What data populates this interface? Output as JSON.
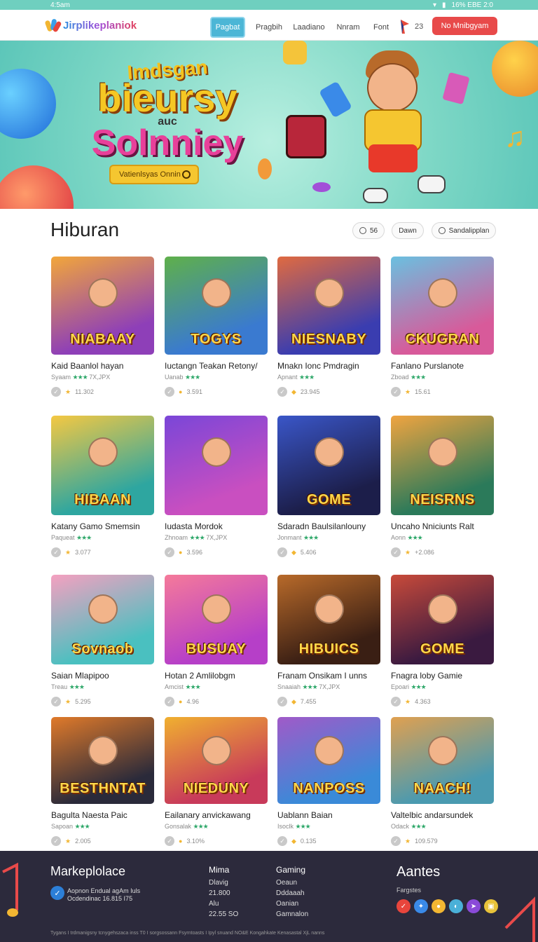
{
  "status_bar": {
    "time": "4:5am",
    "right": "16% EBE 2:0"
  },
  "nav": {
    "logo": "Jirplikeplaniok",
    "tabs": [
      "Pagbat",
      "Pragbih",
      "Laadiano",
      "Nnram",
      "Font"
    ],
    "badge_count": "23",
    "cta": "No Mnibgyam"
  },
  "hero": {
    "title_line1": "Imdsgan",
    "title_line2": "bieursy",
    "title_line3": "auc",
    "title_line4": "Solnniey",
    "button": "Vatienlsyas Onnin"
  },
  "section": {
    "title": "Hiburan",
    "filters": [
      "56",
      "Dawn",
      "Sandalipplan"
    ]
  },
  "games": [
    {
      "title": "Kaid Baanlol hayan",
      "sub": "Syaam",
      "sub_extra": "7X,JPX",
      "meta": "11.302",
      "word": "NIABAAY",
      "accent": "#8e3fb8",
      "bg2": "#f2a63a"
    },
    {
      "title": "Iuctangn Teakan Retony/",
      "sub": "Uanab",
      "sub_extra": "",
      "meta": "3.591",
      "word": "TOGYS",
      "accent": "#3a7ad0",
      "bg2": "#5fb04a"
    },
    {
      "title": "Mnakn Ionc Pmdragin",
      "sub": "Apnant",
      "sub_extra": "",
      "meta": "23.945",
      "word": "NIESNABY",
      "accent": "#3a3db0",
      "bg2": "#e06a40"
    },
    {
      "title": "Fanlano Purslanote",
      "sub": "Zboad",
      "sub_extra": "",
      "meta": "15.61",
      "word": "CKUGRAN",
      "accent": "#d85a9a",
      "bg2": "#6ac0e0"
    },
    {
      "title": "Katany Gamo Smemsin",
      "sub": "Paqueat",
      "sub_extra": "",
      "meta": "3.077",
      "word": "HIBAAN",
      "accent": "#2ea6a0",
      "bg2": "#f5c842"
    },
    {
      "title": "Iudasta Mordok",
      "sub": "Zhnoam",
      "sub_extra": "7X,JPX",
      "meta": "3.596",
      "word": "",
      "accent": "#c94fc0",
      "bg2": "#7a46d8"
    },
    {
      "title": "Sdaradn Baulsilanlouny",
      "sub": "Jonmant",
      "sub_extra": "",
      "meta": "5.406",
      "word": "GOME",
      "accent": "#1c1e4a",
      "bg2": "#3a56c8"
    },
    {
      "title": "Uncaho Nniciunts Ralt",
      "sub": "Aonn",
      "sub_extra": "",
      "meta": "+2.086",
      "word": "NEISRNS",
      "accent": "#2b7a5a",
      "bg2": "#f0a440"
    },
    {
      "title": "Saian Mlapipoo",
      "sub": "Treau",
      "sub_extra": "",
      "meta": "5.295",
      "word": "Sovnaob",
      "accent": "#4ac0c0",
      "bg2": "#f5a0c0"
    },
    {
      "title": "Hotan 2 Amlilobgm",
      "sub": "Amcist",
      "sub_extra": "",
      "meta": "4.96",
      "word": "BUSUAY",
      "accent": "#b63fc8",
      "bg2": "#f57a9a"
    },
    {
      "title": "Franam Onsikam I unns",
      "sub": "Snaaiah",
      "sub_extra": "7X,JPX",
      "meta": "7.455",
      "word": "HIBUICS",
      "accent": "#3a1f14",
      "bg2": "#b86a2a"
    },
    {
      "title": "Fnagra loby Gamie",
      "sub": "Epoari",
      "sub_extra": "",
      "meta": "4.363",
      "word": "GOME",
      "accent": "#3a1a40",
      "bg2": "#c84a3a"
    },
    {
      "title": "Bagulta Naesta Paic",
      "sub": "Sapoan",
      "sub_extra": "",
      "meta": "2.005",
      "word": "BESTHNTAT",
      "accent": "#2a2a3a",
      "bg2": "#e07a2a"
    },
    {
      "title": "Eailanary anvickawang",
      "sub": "Gonsalak",
      "sub_extra": "",
      "meta": "3.10%",
      "word": "NIEDUNY",
      "accent": "#c83a5a",
      "bg2": "#f0b030"
    },
    {
      "title": "Uablann Baian",
      "sub": "Isoclk",
      "sub_extra": "",
      "meta": "0.135",
      "word": "NANPOSS",
      "accent": "#3a8ad8",
      "bg2": "#a05ac8"
    },
    {
      "title": "Valtelbic andarsundek",
      "sub": "Odack",
      "sub_extra": "",
      "meta": "109.579",
      "word": "NAACH!",
      "accent": "#4a9ab0",
      "bg2": "#e0a050"
    }
  ],
  "footer": {
    "title": "Markeplolace",
    "line1": "Aopnon Endual agAm Iuls",
    "line2": "Ocdendinac 16.815 I75",
    "col1": {
      "heading": "Mima",
      "items": [
        "Dlavig",
        "21.800",
        "Alu",
        "22.55 SO"
      ]
    },
    "col2": {
      "heading": "Gaming",
      "items": [
        "Oeaun",
        "Dddaaah",
        "Oanian",
        "Gamnalon"
      ]
    },
    "right_title": "Aantes",
    "right_sub": "Fargstes",
    "copyright": "Tygans I trdmanigsny tcnygehszaca inss T0 I sorgsossann Fsyrntoasts I Ipyl snuand NO&E Kongahkate Kenasastal XjL nanns"
  }
}
